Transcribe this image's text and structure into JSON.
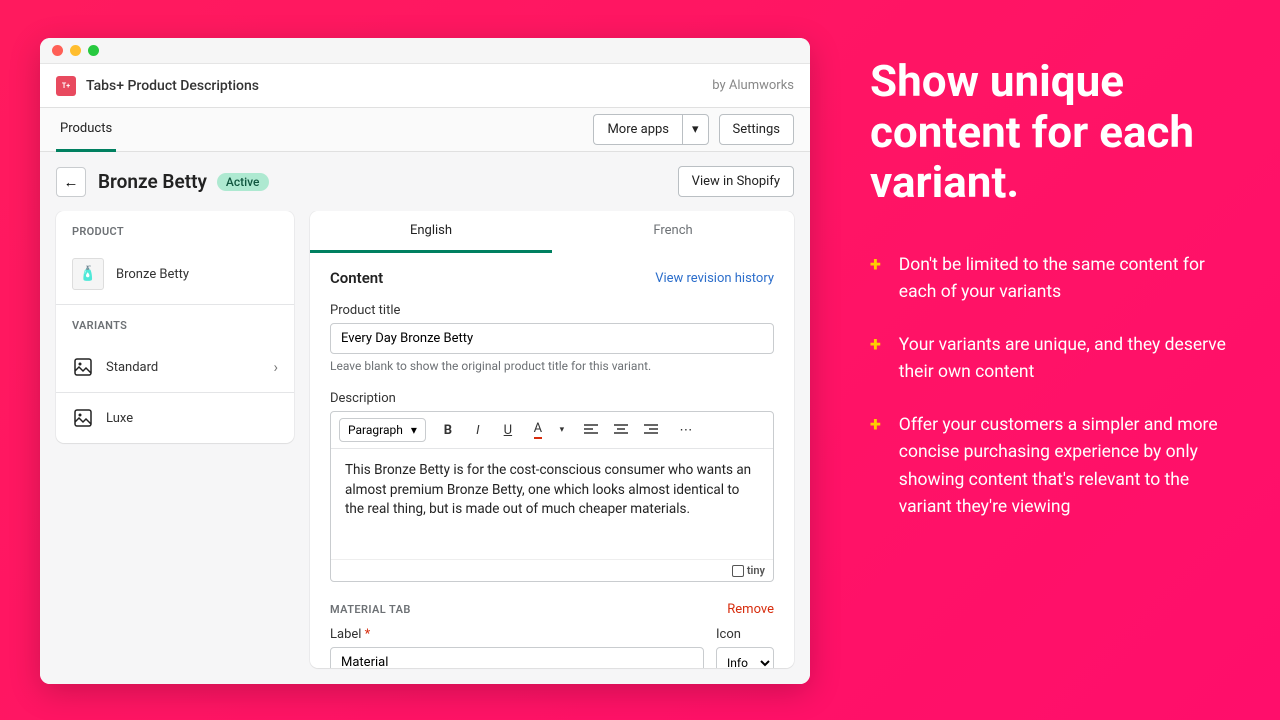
{
  "appbar": {
    "title": "Tabs+ Product Descriptions",
    "byline": "by Alumworks"
  },
  "topbar": {
    "products_tab": "Products",
    "more_apps": "More apps",
    "settings": "Settings"
  },
  "pagehead": {
    "title": "Bronze Betty",
    "status": "Active",
    "view_in_shopify": "View in Shopify"
  },
  "sidepanel": {
    "product_header": "PRODUCT",
    "product_name": "Bronze Betty",
    "variants_header": "VARIANTS",
    "variants": [
      {
        "name": "Standard",
        "selected": true
      },
      {
        "name": "Luxe",
        "selected": false
      }
    ]
  },
  "lang_tabs": {
    "english": "English",
    "french": "French"
  },
  "content": {
    "heading": "Content",
    "revision_link": "View revision history",
    "title_label": "Product title",
    "title_value": "Every Day Bronze Betty",
    "title_hint": "Leave blank to show the original product title for this variant.",
    "desc_label": "Description",
    "format_selector": "Paragraph",
    "desc_body": "This Bronze Betty is for the cost-conscious consumer who wants an almost premium Bronze Betty, one which looks almost identical to the real thing, but is made out of much cheaper materials.",
    "tiny_label": "tiny"
  },
  "material_tab": {
    "section_title": "MATERIAL TAB",
    "remove": "Remove",
    "label_label": "Label",
    "label_value": "Material",
    "icon_label": "Icon",
    "icon_value": "Info"
  },
  "marketing": {
    "headline": "Show unique content for each variant.",
    "bullets": [
      "Don't be limited to the same content for each of your variants",
      "Your variants are unique, and they deserve their own content",
      "Offer your customers a simpler and more concise purchasing experience by only showing content that's relevant to the variant they're viewing"
    ]
  }
}
